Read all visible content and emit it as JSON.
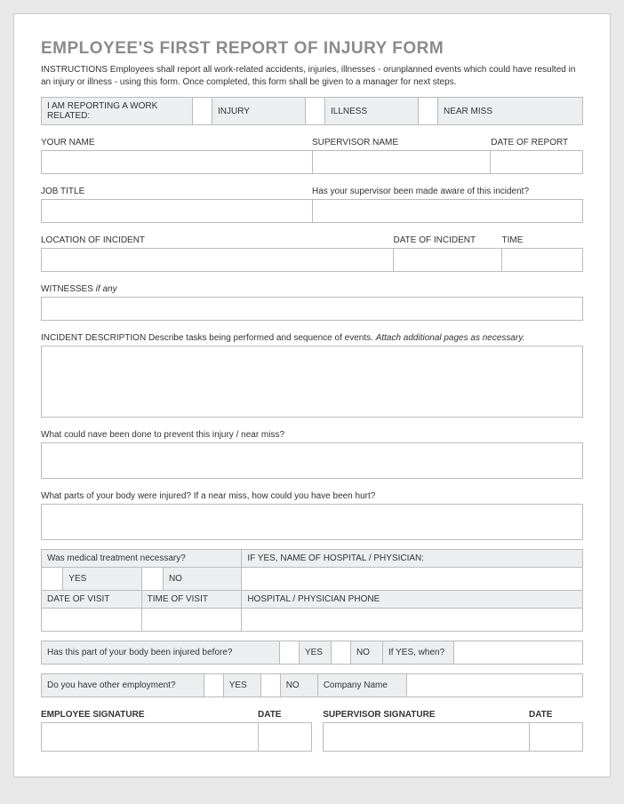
{
  "title": "EMPLOYEE'S FIRST REPORT OF INJURY FORM",
  "instructions_label": "INSTRUCTIONS",
  "instructions_text": "  Employees shall report all work-related accidents, injuries, illnesses - orunplanned events which could have resulted in an injury or illness - using this form. Once completed, this form shall be given to a manager for next steps.",
  "reporting": {
    "label": "I AM REPORTING A WORK RELATED:",
    "options": [
      "INJURY",
      "ILLNESS",
      "NEAR MISS"
    ]
  },
  "fields": {
    "your_name": "YOUR NAME",
    "supervisor_name": "SUPERVISOR NAME",
    "date_of_report": "DATE OF REPORT",
    "job_title": "JOB TITLE",
    "supervisor_aware": "Has your supervisor been made aware of this incident?",
    "location": "LOCATION OF INCIDENT",
    "date_of_incident": "DATE OF INCIDENT",
    "time": "TIME",
    "witnesses_label": "WITNESSES",
    "witnesses_if_any": "  if any",
    "incident_desc_label": "INCIDENT DESCRIPTION",
    "incident_desc_text": "  Describe tasks being performed and sequence of events.  ",
    "incident_desc_attach": "Attach additional pages as necessary.",
    "prevention": "What could nave been done to prevent this injury / near miss?",
    "body_parts": "What parts of your body were injured?  If a near miss, how could you have been hurt?"
  },
  "medical": {
    "necessary": "Was medical treatment necessary?",
    "if_yes_name": "IF YES, NAME OF HOSPITAL / PHYSICIAN:",
    "yes": "YES",
    "no": "NO",
    "date_visit": "DATE OF VISIT",
    "time_visit": "TIME OF VISIT",
    "phone": "HOSPITAL / PHYSICIAN PHONE"
  },
  "prior": {
    "q": "Has this part of your body been injured before?",
    "yes": "YES",
    "no": "NO",
    "if_yes_when": "If YES, when?"
  },
  "employment": {
    "q": "Do you have other employment?",
    "yes": "YES",
    "no": "NO",
    "company": "Company Name"
  },
  "sig": {
    "employee": "EMPLOYEE SIGNATURE",
    "date": "DATE",
    "supervisor": "SUPERVISOR SIGNATURE"
  }
}
